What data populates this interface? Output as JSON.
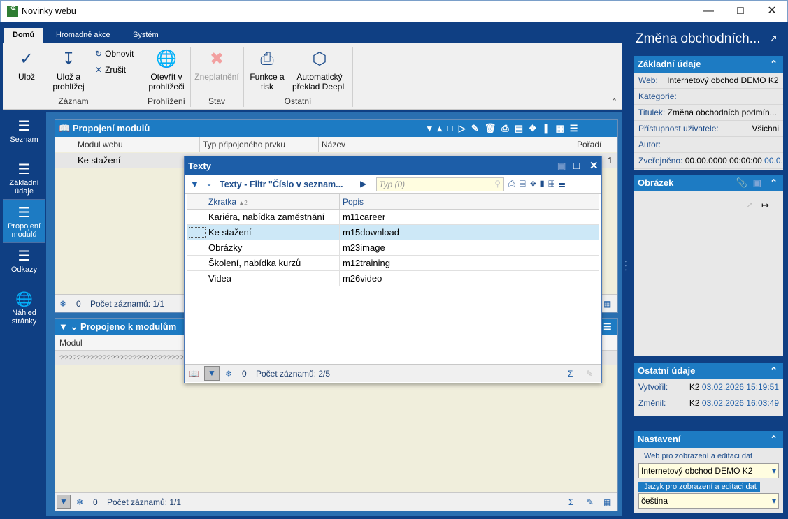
{
  "window": {
    "title": "Novinky webu",
    "app_icon": "K2"
  },
  "ribbon": {
    "tabs": [
      {
        "label": "Domů",
        "active": true
      },
      {
        "label": "Hromadné akce"
      },
      {
        "label": "Systém"
      }
    ],
    "buttons": {
      "save": "Ulož",
      "save_and_view": "Ulož a prohlížej",
      "refresh": "Obnovit",
      "cancel": "Zrušit",
      "open_browser": "Otevřít v prohlížeči",
      "invalidate": "Zneplatnění",
      "functions_print": "Funkce a tisk",
      "deepl": "Automatický překlad DeepL"
    },
    "groups": {
      "record": "Záznam",
      "view": "Prohlížení",
      "state": "Stav",
      "other": "Ostatní"
    }
  },
  "nav": {
    "items": [
      {
        "label": "Seznam",
        "icon": "list-icon"
      },
      {
        "label": "Základní údaje",
        "icon": "list-icon"
      },
      {
        "label": "Propojení modulů",
        "icon": "list-icon",
        "active": true
      },
      {
        "label": "Odkazy",
        "icon": "list-icon"
      },
      {
        "label": "Náhled stránky",
        "icon": "globe-icon"
      }
    ]
  },
  "modules_panel": {
    "title": "Propojení modulů",
    "columns": [
      "Modul webu",
      "Typ připojeného prvku",
      "Název",
      "Pořadí"
    ],
    "rows": [
      {
        "module": "Ke stažení",
        "order": "1"
      }
    ],
    "status": {
      "count": "0",
      "records": "Počet záznamů: 1/1"
    }
  },
  "linked_panel": {
    "title": "Propojeno k modulům",
    "columns": [
      "Modul"
    ],
    "rows": [
      "??????????????????????????????"
    ],
    "status": {
      "count": "0",
      "records": "Počet záznamů: 1/1"
    }
  },
  "dialog": {
    "title": "Texty",
    "filter_label": "Texty - Filtr \"Číslo v seznam...",
    "search_placeholder": "Typ (0)",
    "columns": [
      "Zkratka",
      "Popis"
    ],
    "sort_indicator": "2",
    "rows": [
      {
        "abbr": "Kariéra, nabídka zaměstnání",
        "desc": "m11career"
      },
      {
        "abbr": "Ke stažení",
        "desc": "m15download",
        "selected": true
      },
      {
        "abbr": "Obrázky",
        "desc": "m23image"
      },
      {
        "abbr": "Školení, nabídka kurzů",
        "desc": "m12training"
      },
      {
        "abbr": "Videa",
        "desc": "m26video"
      }
    ],
    "status": {
      "count": "0",
      "records": "Počet záznamů: 2/5"
    }
  },
  "right": {
    "title": "Změna obchodních...",
    "basic": {
      "heading": "Základní údaje",
      "web_label": "Web:",
      "web_value": "Internetový obchod DEMO K2",
      "category_label": "Kategorie:",
      "title_label": "Titulek:",
      "title_value": "Změna obchodních podmín...",
      "access_label": "Přístupnost uživatele:",
      "access_value": "Všichni",
      "author_label": "Autor:",
      "published_label": "Zveřejněno:",
      "published_value": "00.00.0000 00:00:00",
      "published_value2": "00.0..."
    },
    "image": {
      "heading": "Obrázek"
    },
    "other": {
      "heading": "Ostatní údaje",
      "created_label": "Vytvořil:",
      "created_user": "K2",
      "created_date": "03.02.2026 15:19:51",
      "changed_label": "Změnil:",
      "changed_user": "K2",
      "changed_date": "03.02.2026 16:03:49"
    },
    "settings": {
      "heading": "Nastavení",
      "web_label": "Web pro zobrazení a editaci dat",
      "web_value": "Internetový obchod DEMO K2",
      "lang_label": "Jazyk pro zobrazení a editaci dat",
      "lang_value": "čeština"
    }
  },
  "colors": {
    "dark_blue": "#0f3f83",
    "accent_blue": "#1d7bc3",
    "selection": "#cde8f7"
  }
}
